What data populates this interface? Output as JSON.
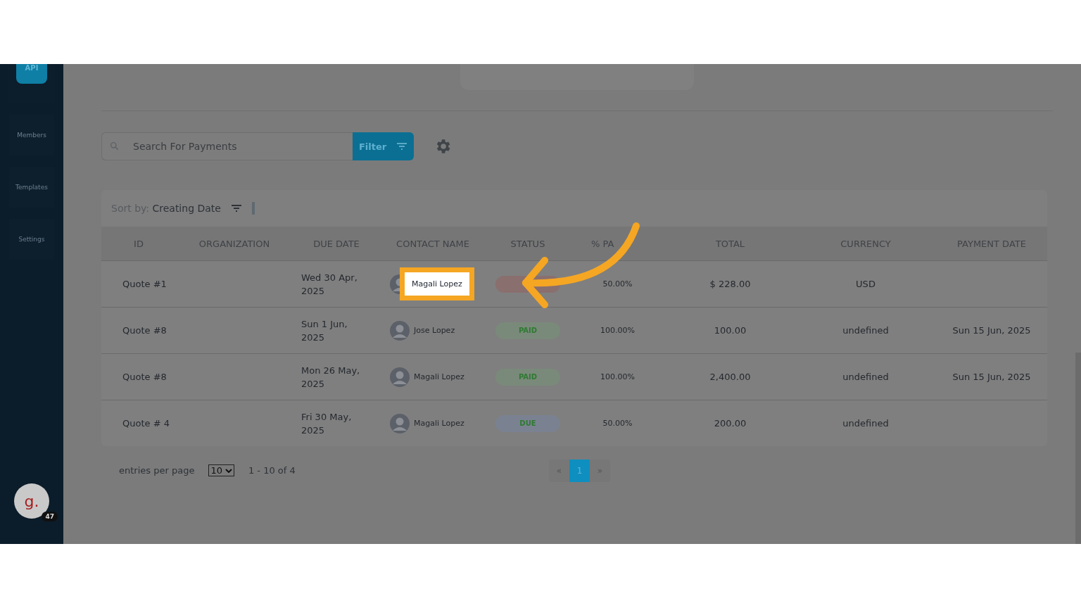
{
  "sidebar": {
    "logo_text": "API",
    "items": [
      {
        "label": "Members"
      },
      {
        "label": "Templates"
      },
      {
        "label": "Settings"
      }
    ]
  },
  "account": {
    "initial": "g.",
    "badge": "47"
  },
  "toolbar": {
    "search": {
      "placeholder": "Search For Payments"
    },
    "filter_button": "Filter"
  },
  "table": {
    "sort": {
      "label": "Sort by:",
      "value": "Creating Date"
    },
    "columns": [
      "ID",
      "ORGANIZATION",
      "DUE DATE",
      "CONTACT NAME",
      "STATUS",
      "% PA",
      "TOTAL",
      "CURRENCY",
      "PAYMENT DATE"
    ],
    "rows": [
      {
        "id": "Quote #1",
        "due_date": "Wed 30 Apr, 2025",
        "contact": "Magali Lopez",
        "highlighted": true,
        "status": {
          "color": "#8a6f6f"
        },
        "paid": "50.00%",
        "total": "$ 228.00",
        "currency": "USD"
      },
      {
        "id": "Quote #8",
        "due_date": "Sun 1 Jun, 2025",
        "contact": "Jose Lopez",
        "highlighted": false,
        "status": {
          "label": "PAID",
          "color": "#7a8a7a"
        },
        "paid": "100.00%",
        "total": "100.00",
        "currency": "undefined",
        "payment_date": "Sun 15 Jun, 2025"
      },
      {
        "id": "Quote #8",
        "due_date": "Mon 26 May, 2025",
        "contact": "Magali Lopez",
        "highlighted": false,
        "status": {
          "label": "PAID",
          "color": "#7a8a7a"
        },
        "paid": "100.00%",
        "total": "2,400.00",
        "currency": "undefined",
        "payment_date": "Sun 15 Jun, 2025"
      },
      {
        "id": "Quote # 4",
        "due_date": "Fri 30 May, 2025",
        "contact": "Magali Lopez",
        "highlighted": false,
        "status": {
          "label": "DUE",
          "color": "#7a8291"
        },
        "paid": "50.00%",
        "total": "200.00",
        "currency": "undefined"
      }
    ]
  },
  "pagination": {
    "per_page_label": "entries per page",
    "per_page": "10",
    "range": "1 - 10 of 4",
    "prev": "«",
    "next": "»",
    "pages": [
      {
        "label": "1",
        "selected": true
      }
    ]
  }
}
